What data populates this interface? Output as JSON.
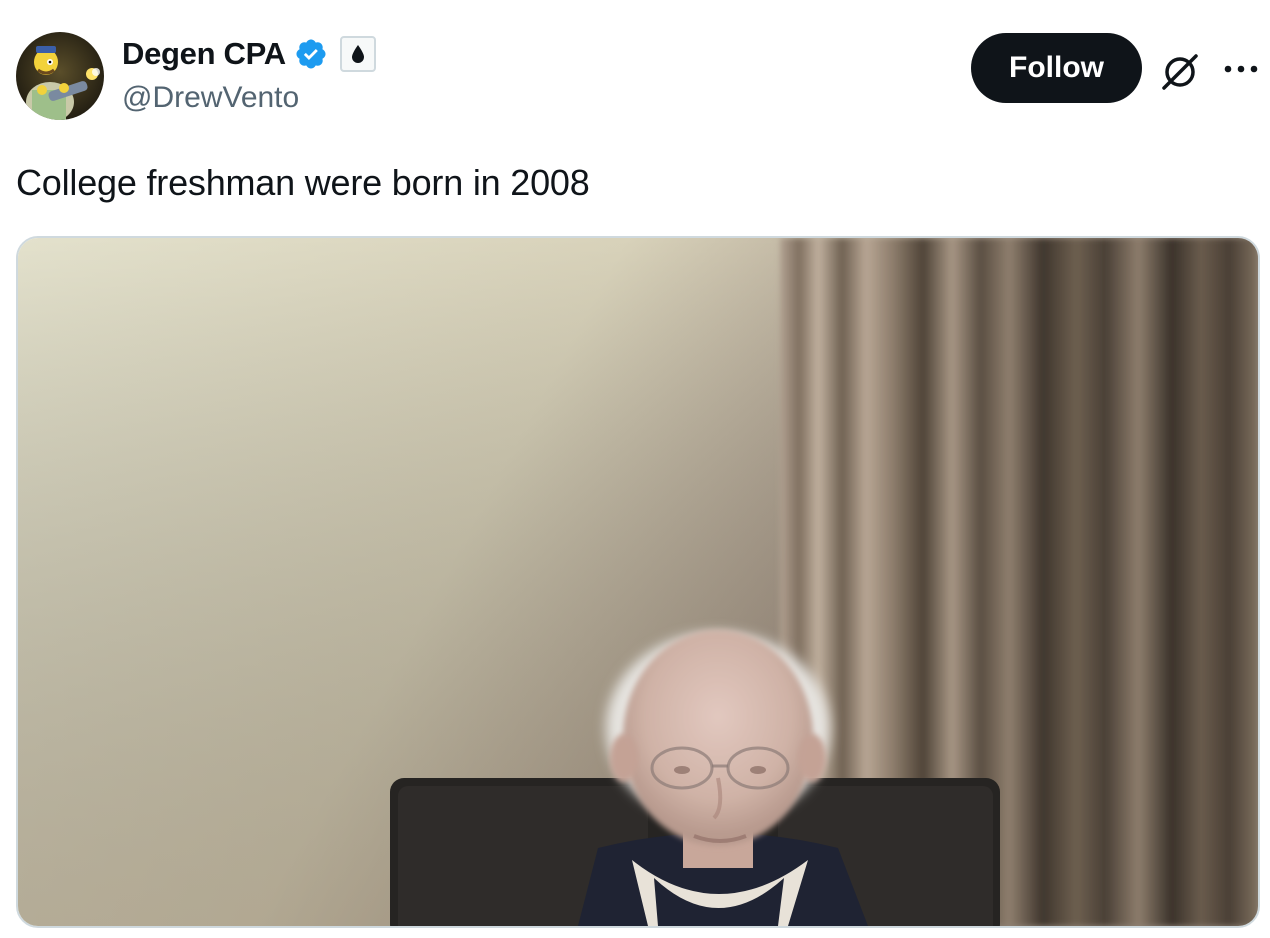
{
  "author": {
    "display_name": "Degen CPA",
    "handle": "@DrewVento",
    "verified": true,
    "verified_badge_color": "#1d9bf0",
    "affiliate_badge_icon": "drop-icon"
  },
  "actions": {
    "follow_label": "Follow",
    "grok_icon": "grok-icon",
    "more_icon": "more-horizontal-icon"
  },
  "tweet": {
    "text": "College freshman were born in 2008"
  },
  "colors": {
    "follow_bg": "#0f1419",
    "text_primary": "#0f1419",
    "text_secondary": "#536471",
    "border": "#cfd9de"
  }
}
